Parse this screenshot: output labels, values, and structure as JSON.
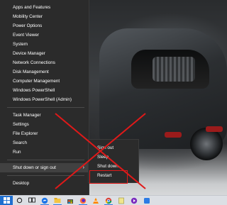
{
  "menu": {
    "items": [
      {
        "label": "Apps and Features"
      },
      {
        "label": "Mobility Center"
      },
      {
        "label": "Power Options"
      },
      {
        "label": "Event Viewer"
      },
      {
        "label": "System"
      },
      {
        "label": "Device Manager"
      },
      {
        "label": "Network Connections"
      },
      {
        "label": "Disk Management"
      },
      {
        "label": "Computer Management"
      },
      {
        "label": "Windows PowerShell"
      },
      {
        "label": "Windows PowerShell (Admin)"
      },
      {
        "label": "Task Manager"
      },
      {
        "label": "Settings"
      },
      {
        "label": "File Explorer"
      },
      {
        "label": "Search"
      },
      {
        "label": "Run"
      },
      {
        "label": "Shut down or sign out"
      },
      {
        "label": "Desktop"
      }
    ],
    "submenu_arrow": "›"
  },
  "submenu": {
    "items": [
      {
        "label": "Sign out"
      },
      {
        "label": "Sleep"
      },
      {
        "label": "Shut down"
      },
      {
        "label": "Restart"
      }
    ]
  },
  "annotation": {
    "color": "#e01919"
  },
  "taskbar": {
    "accent": "#2c7be5",
    "icons": [
      "windows-logo-icon",
      "search-icon",
      "task-view-icon",
      "edge-icon",
      "file-explorer-icon",
      "store-icon",
      "firefox-icon",
      "vlc-icon",
      "chrome-icon",
      "notes-icon",
      "media-icon",
      "app-icon"
    ]
  }
}
